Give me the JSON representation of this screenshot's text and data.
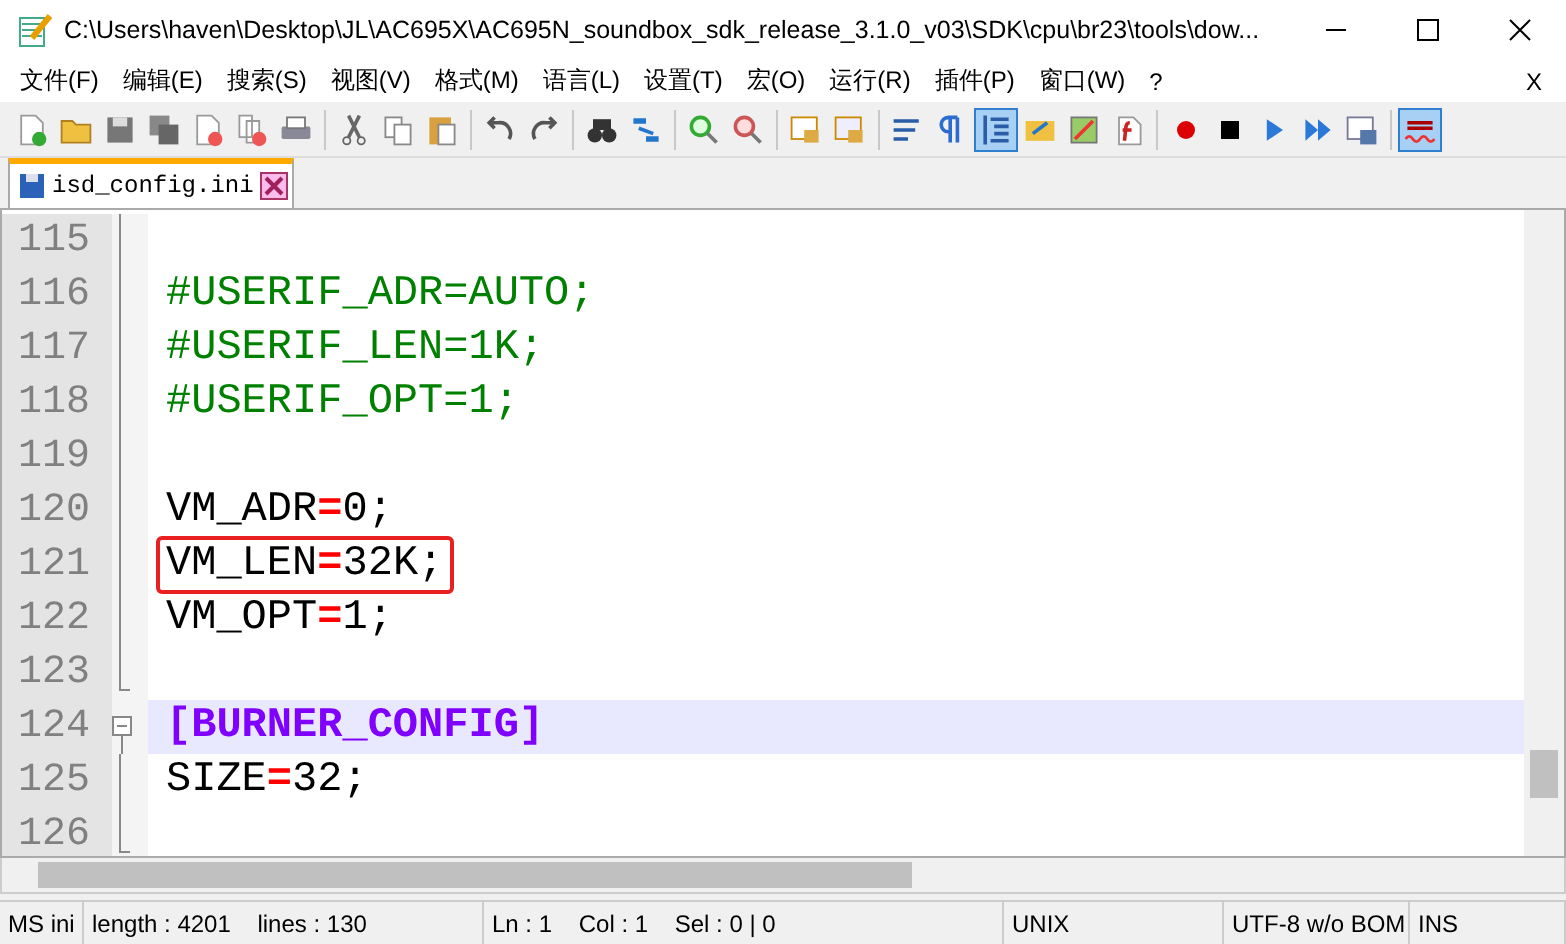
{
  "window": {
    "title": "C:\\Users\\haven\\Desktop\\JL\\AC695X\\AC695N_soundbox_sdk_release_3.1.0_v03\\SDK\\cpu\\br23\\tools\\dow..."
  },
  "menu": {
    "items": [
      "文件(F)",
      "编辑(E)",
      "搜索(S)",
      "视图(V)",
      "格式(M)",
      "语言(L)",
      "设置(T)",
      "宏(O)",
      "运行(R)",
      "插件(P)",
      "窗口(W)",
      "?"
    ],
    "close": "X"
  },
  "toolbar": [
    {
      "kind": "new",
      "on": false
    },
    {
      "kind": "open",
      "on": false
    },
    {
      "kind": "save",
      "on": false
    },
    {
      "kind": "save-all",
      "on": false
    },
    {
      "kind": "close",
      "on": false
    },
    {
      "kind": "close-all",
      "on": false
    },
    {
      "kind": "print",
      "on": false
    },
    {
      "kind": "sep"
    },
    {
      "kind": "cut",
      "on": false
    },
    {
      "kind": "copy",
      "on": false
    },
    {
      "kind": "paste",
      "on": false
    },
    {
      "kind": "sep"
    },
    {
      "kind": "undo",
      "on": false
    },
    {
      "kind": "redo",
      "on": false
    },
    {
      "kind": "sep"
    },
    {
      "kind": "find",
      "on": false
    },
    {
      "kind": "replace",
      "on": false
    },
    {
      "kind": "sep"
    },
    {
      "kind": "zoom-in",
      "on": false
    },
    {
      "kind": "zoom-out",
      "on": false
    },
    {
      "kind": "sep"
    },
    {
      "kind": "sync-v",
      "on": false
    },
    {
      "kind": "sync-h",
      "on": false
    },
    {
      "kind": "sep"
    },
    {
      "kind": "wrap",
      "on": false
    },
    {
      "kind": "pilcrow",
      "on": false
    },
    {
      "kind": "indent",
      "on": true
    },
    {
      "kind": "udl",
      "on": false
    },
    {
      "kind": "map",
      "on": false
    },
    {
      "kind": "func",
      "on": false
    },
    {
      "kind": "sep"
    },
    {
      "kind": "record",
      "on": false
    },
    {
      "kind": "stop",
      "on": false
    },
    {
      "kind": "play",
      "on": false
    },
    {
      "kind": "play-multi",
      "on": false
    },
    {
      "kind": "save-macro",
      "on": false
    },
    {
      "kind": "sep"
    },
    {
      "kind": "spell",
      "on": true
    }
  ],
  "tabs": [
    {
      "label": "isd_config.ini",
      "selected": true
    }
  ],
  "editor": {
    "lines": [
      {
        "number": "115",
        "current": false,
        "boxed": false
      },
      {
        "number": "116",
        "current": false,
        "boxed": false,
        "tokens": [
          {
            "kind": "comment",
            "text": "#USERIF_ADR=AUTO;"
          }
        ]
      },
      {
        "number": "117",
        "current": false,
        "boxed": false,
        "tokens": [
          {
            "kind": "comment",
            "text": "#USERIF_LEN=1K;"
          }
        ]
      },
      {
        "number": "118",
        "current": false,
        "boxed": false,
        "tokens": [
          {
            "kind": "comment",
            "text": "#USERIF_OPT=1;"
          }
        ]
      },
      {
        "number": "119",
        "current": false,
        "boxed": false
      },
      {
        "number": "120",
        "current": false,
        "boxed": false,
        "tokens": [
          {
            "kind": "key",
            "text": "VM_ADR"
          },
          {
            "kind": "op",
            "text": "="
          },
          {
            "kind": "value",
            "text": "0;"
          }
        ]
      },
      {
        "number": "121",
        "current": false,
        "boxed": true,
        "tokens": [
          {
            "kind": "key",
            "text": "VM_LEN"
          },
          {
            "kind": "op",
            "text": "="
          },
          {
            "kind": "value",
            "text": "32K;"
          }
        ]
      },
      {
        "number": "122",
        "current": false,
        "boxed": false,
        "tokens": [
          {
            "kind": "key",
            "text": "VM_OPT"
          },
          {
            "kind": "op",
            "text": "="
          },
          {
            "kind": "value",
            "text": "1;"
          }
        ]
      },
      {
        "number": "123",
        "current": false,
        "boxed": false
      },
      {
        "number": "124",
        "current": true,
        "boxed": false,
        "tokens": [
          {
            "kind": "section",
            "text": "[BURNER_CONFIG]"
          }
        ]
      },
      {
        "number": "125",
        "current": false,
        "boxed": false,
        "tokens": [
          {
            "kind": "key",
            "text": "SIZE"
          },
          {
            "kind": "op",
            "text": "="
          },
          {
            "kind": "value",
            "text": "32;"
          }
        ]
      },
      {
        "number": "126",
        "current": false,
        "boxed": false
      }
    ]
  },
  "status_bar": [
    "MS ini",
    "length : 4201    lines : 130",
    "Ln : 1    Col : 1    Sel : 0 | 0",
    "UNIX",
    "UTF-8 w/o BOM",
    "INS"
  ]
}
